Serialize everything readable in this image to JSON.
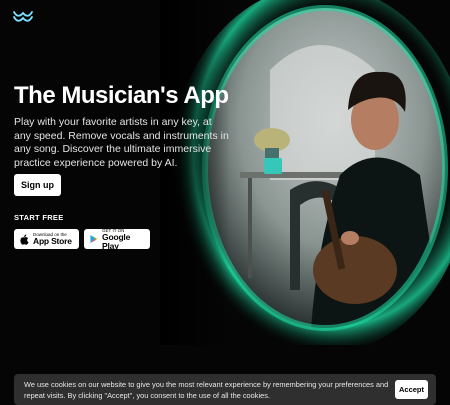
{
  "logo": {
    "icon": "wave-logo-icon",
    "color": "#7fe0ff"
  },
  "hero": {
    "title": "The Musician's App",
    "description": "Play with your favorite artists in any key, at any speed. Remove vocals and instruments in any song. Discover the ultimate immersive practice experience powered by AI.",
    "signup_label": "Sign up",
    "start_free_label": "START FREE",
    "image_icon": "musician-playing-guitar-photo",
    "accent_color": "#1fe0a5"
  },
  "stores": {
    "apple": {
      "small": "Download on the",
      "big": "App Store",
      "icon": "apple-icon"
    },
    "google": {
      "small": "GET IT ON",
      "big": "Google Play",
      "icon": "google-play-icon"
    }
  },
  "cookie": {
    "text": "We use cookies on our website to give you the most relevant experience by remembering your preferences and repeat visits. By clicking \"Accept\", you consent to the use of all the cookies.",
    "accept_label": "Accept"
  }
}
